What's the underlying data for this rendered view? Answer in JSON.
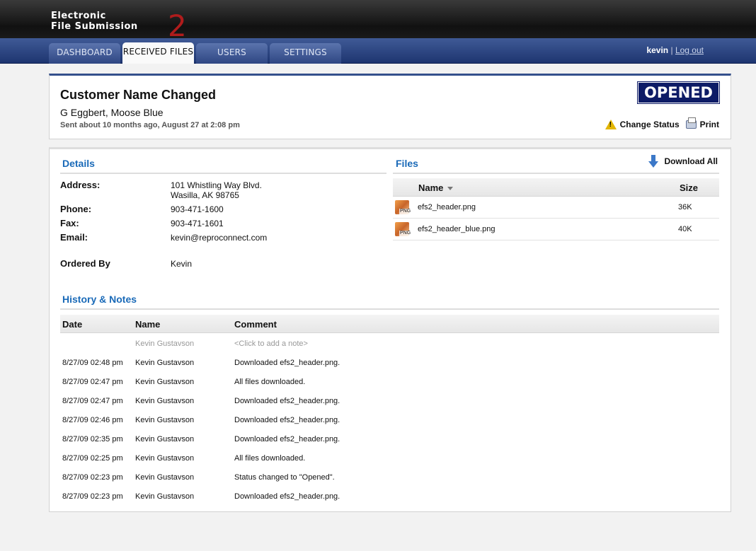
{
  "app": {
    "logo_line1": "Electronic",
    "logo_line2": "File Submission",
    "logo_mark": "2"
  },
  "nav": {
    "tabs": [
      {
        "label": "DASHBOARD"
      },
      {
        "label": "RECEIVED FILES"
      },
      {
        "label": "USERS"
      },
      {
        "label": "SETTINGS"
      }
    ],
    "active_tab": "RECEIVED FILES",
    "username": "kevin",
    "separator": "|",
    "logout": "Log out"
  },
  "request": {
    "title": "Customer Name Changed",
    "customer": "G Eggbert, Moose Blue",
    "sent": "Sent about 10 months ago, August 27 at 2:08 pm",
    "status": "OPENED",
    "change_status": "Change Status",
    "print": "Print"
  },
  "details": {
    "heading": "Details",
    "address_label": "Address:",
    "address_line1": "101 Whistling Way Blvd.",
    "address_line2": "Wasilla, AK 98765",
    "phone_label": "Phone:",
    "phone": "903-471-1600",
    "fax_label": "Fax:",
    "fax": "903-471-1601",
    "email_label": "Email:",
    "email": "kevin@reproconnect.com",
    "ordered_by_label": "Ordered By",
    "ordered_by": "Kevin"
  },
  "files": {
    "heading": "Files",
    "download_all": "Download All",
    "col_name": "Name",
    "col_size": "Size",
    "rows": [
      {
        "name": "efs2_header.png",
        "size": "36K"
      },
      {
        "name": "efs2_header_blue.png",
        "size": "40K"
      }
    ]
  },
  "history": {
    "heading": "History & Notes",
    "col_date": "Date",
    "col_name": "Name",
    "col_comment": "Comment",
    "add_note_name": "Kevin Gustavson",
    "add_note_placeholder": "<Click to add a note>",
    "rows": [
      {
        "date": "8/27/09 02:48 pm",
        "name": "Kevin Gustavson",
        "comment": "Downloaded efs2_header.png."
      },
      {
        "date": "8/27/09 02:47 pm",
        "name": "Kevin Gustavson",
        "comment": "All files downloaded."
      },
      {
        "date": "8/27/09 02:47 pm",
        "name": "Kevin Gustavson",
        "comment": "Downloaded efs2_header.png."
      },
      {
        "date": "8/27/09 02:46 pm",
        "name": "Kevin Gustavson",
        "comment": "Downloaded efs2_header.png."
      },
      {
        "date": "8/27/09 02:35 pm",
        "name": "Kevin Gustavson",
        "comment": "Downloaded efs2_header.png."
      },
      {
        "date": "8/27/09 02:25 pm",
        "name": "Kevin Gustavson",
        "comment": "All files downloaded."
      },
      {
        "date": "8/27/09 02:23 pm",
        "name": "Kevin Gustavson",
        "comment": "Status changed to \"Opened\"."
      },
      {
        "date": "8/27/09 02:23 pm",
        "name": "Kevin Gustavson",
        "comment": "Downloaded efs2_header.png."
      }
    ]
  },
  "colors": {
    "nav_blue": "#2e4683",
    "status_bg": "#0d1b66",
    "heading_blue": "#1a6ab8",
    "logo_accent": "#b01c1c"
  }
}
